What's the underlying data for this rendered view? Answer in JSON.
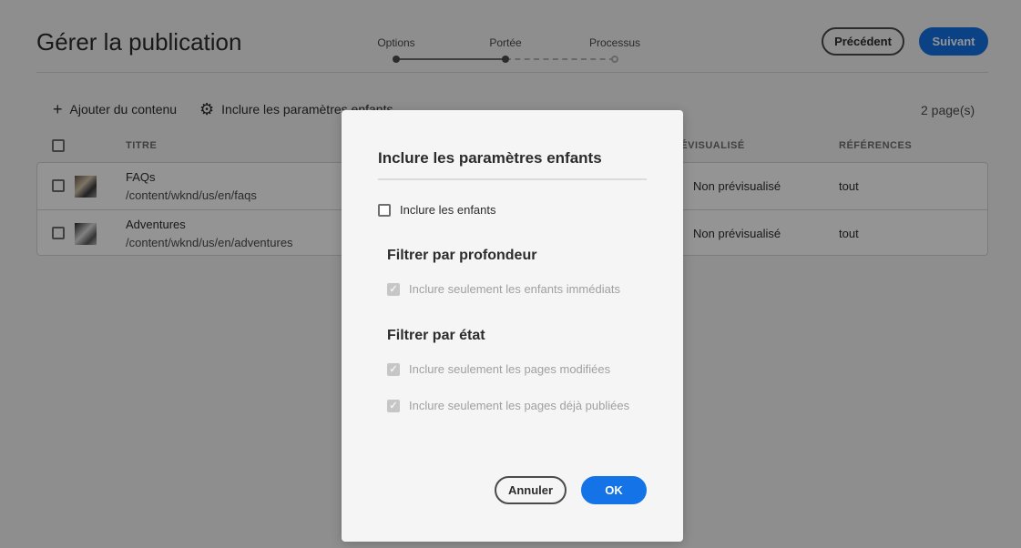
{
  "header": {
    "title": "Gérer la publication",
    "steps": [
      {
        "label": "Options",
        "state": "done"
      },
      {
        "label": "Portée",
        "state": "current"
      },
      {
        "label": "Processus",
        "state": "todo"
      }
    ],
    "previous_label": "Précédent",
    "next_label": "Suivant"
  },
  "toolbar": {
    "add_content_label": "Ajouter du contenu",
    "include_children_label": "Inclure les paramètres enfants",
    "pages_count": "2 page(s)"
  },
  "table": {
    "columns": {
      "title": "TITRE",
      "status": "PRÉVISUALISÉ",
      "references": "RÉFÉRENCES"
    },
    "rows": [
      {
        "title": "FAQs",
        "path": "/content/wknd/us/en/faqs",
        "status": "Non prévisualisé",
        "references": "tout"
      },
      {
        "title": "Adventures",
        "path": "/content/wknd/us/en/adventures",
        "status": "Non prévisualisé",
        "references": "tout"
      }
    ]
  },
  "dialog": {
    "title": "Inclure les paramètres enfants",
    "include_children_label": "Inclure les enfants",
    "depth_heading": "Filtrer par profondeur",
    "immediate_children_label": "Inclure seulement les enfants immédiats",
    "state_heading": "Filtrer par état",
    "modified_pages_label": "Inclure seulement les pages modifiées",
    "published_pages_label": "Inclure seulement les pages déjà publiées",
    "cancel_label": "Annuler",
    "ok_label": "OK"
  },
  "colors": {
    "accent": "#1473e6",
    "overlay": "rgba(0,0,0,0.42)"
  }
}
